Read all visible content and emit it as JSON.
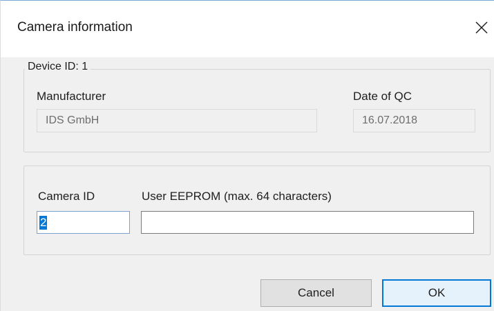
{
  "window": {
    "title": "Camera information",
    "close_icon": "close-icon"
  },
  "device_group": {
    "legend": "Device ID: 1",
    "manufacturer_label": "Manufacturer",
    "manufacturer_value": "IDS GmbH",
    "date_label": "Date of QC",
    "date_value": "16.07.2018"
  },
  "camera_group": {
    "camera_id_label": "Camera ID",
    "camera_id_value": "2",
    "eeprom_label": "User EEPROM (max. 64 characters)",
    "eeprom_value": ""
  },
  "buttons": {
    "cancel": "Cancel",
    "ok": "OK"
  },
  "colors": {
    "accent": "#0078d7",
    "background": "#f0f0f0",
    "titlebar": "#ffffff"
  }
}
